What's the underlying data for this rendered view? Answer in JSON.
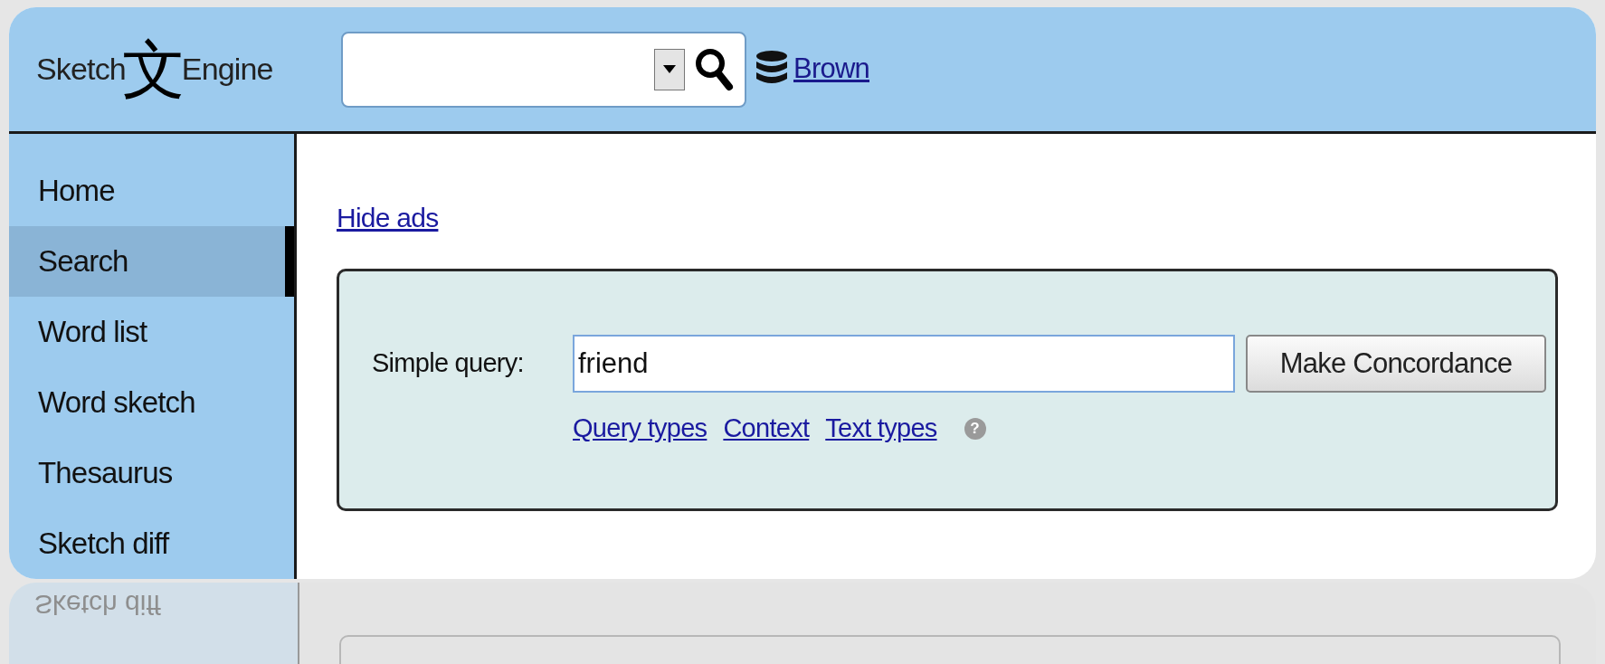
{
  "header": {
    "logo": {
      "left": "Sketch",
      "glyph": "文",
      "right": "Engine"
    },
    "corpus_link": "Brown"
  },
  "sidebar": {
    "items": [
      {
        "label": "Home",
        "selected": false
      },
      {
        "label": "Search",
        "selected": true
      },
      {
        "label": "Word list",
        "selected": false
      },
      {
        "label": "Word sketch",
        "selected": false
      },
      {
        "label": "Thesaurus",
        "selected": false
      },
      {
        "label": "Sketch diff",
        "selected": false
      }
    ]
  },
  "content": {
    "hide_ads_link": "Hide ads",
    "query_form": {
      "label": "Simple query:",
      "value": "friend",
      "button": "Make Concordance",
      "links": [
        "Query types",
        "Context",
        "Text types"
      ],
      "help": "?"
    }
  },
  "reflection": {
    "label": "Sketch diff"
  }
}
